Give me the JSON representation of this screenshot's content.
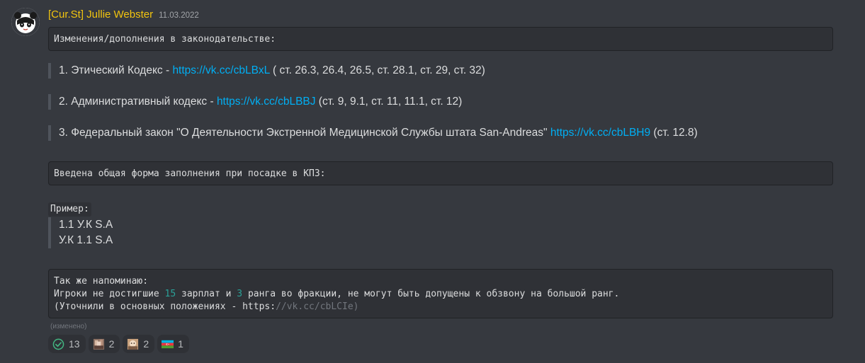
{
  "message": {
    "author": "[Cur.St] Jullie Webster",
    "timestamp": "11.03.2022",
    "code1": "Изменения/дополнения в законодательстве:",
    "laws": [
      {
        "text": "1. Этический Кодекс - ",
        "link": "https://vk.cc/cbLBxL",
        "suffix": " ( ст. 26.3, 26.4, 26.5, ст. 28.1, ст. 29, ст. 32)"
      },
      {
        "text": "2. Административный кодекс - ",
        "link": "https://vk.cc/cbLBBJ",
        "suffix": " (ст. 9, 9.1, ст. 11, 11.1, ст. 12)"
      },
      {
        "text": "3. Федеральный закон \"О Деятельности Экстренной Медицинской Службы штата San-Andreas\" ",
        "link": "https://vk.cc/cbLBH9",
        "suffix": " (ст. 12.8)"
      }
    ],
    "code2": "Введена общая форма заполнения при посадке в КПЗ:",
    "example_label": "Пример:",
    "example_lines": [
      "1.1 У.К S.A",
      "У.К 1.1 S.A"
    ],
    "code3": {
      "line1": "Так же напоминаю:",
      "line2_a": "Игроки не достигшие ",
      "line2_num1": "15",
      "line2_b": " зарплат и ",
      "line2_num2": "3",
      "line2_c": " ранга во фракции, не могут быть допущены к обзвону на большой ранг.",
      "line3_a": "(Уточнили в основных положениях - https:",
      "line3_b": "//vk.cc/cbLCIe)"
    },
    "edited": "(изменено)",
    "reactions": [
      {
        "icon": "check-icon",
        "count": "13"
      },
      {
        "icon": "custom-emoji-1",
        "count": "2"
      },
      {
        "icon": "custom-emoji-2",
        "count": "2"
      },
      {
        "icon": "azerbaijan-flag-icon",
        "count": "1"
      }
    ]
  }
}
